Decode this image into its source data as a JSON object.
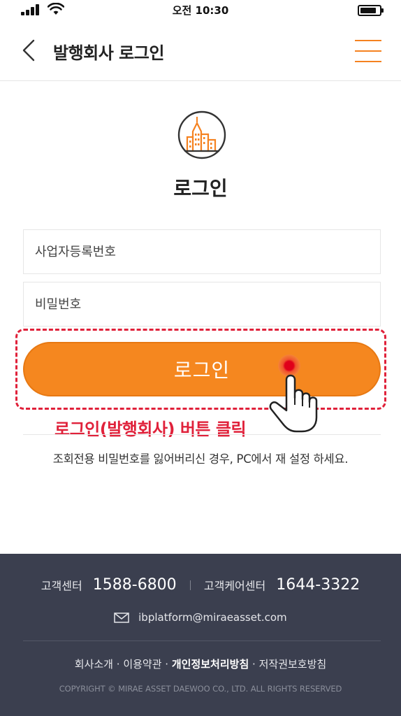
{
  "status_bar": {
    "time": "오전 10:30",
    "battery_level": 0.85
  },
  "header": {
    "title": "발행회사 로그인",
    "back_icon": "chevron-left-icon",
    "menu_icon": "hamburger-menu-icon"
  },
  "main": {
    "logo_icon": "building-icon",
    "heading": "로그인",
    "business_number_placeholder": "사업자등록번호",
    "password_placeholder": "비밀번호",
    "login_button_label": "로그인",
    "instruction": "로그인(발행회사) 버튼 클릭",
    "password_notice": "조회전용 비밀번호를 잃어버리신 경우, PC에서 재 설정 하세요."
  },
  "footer": {
    "customer_center_label": "고객센터",
    "customer_center_number": "1588-6800",
    "customer_care_label": "고객케어센터",
    "customer_care_number": "1644-3322",
    "email": "ibplatform@miraeasset.com",
    "links": {
      "about": "회사소개",
      "terms": "이용약관",
      "privacy": "개인정보처리방침",
      "copyright_policy": "저작권보호방침",
      "separator": "·"
    },
    "copyright": "COPYRIGHT © MIRAE ASSET DAEWOO CO., LTD. ALL RIGHTS RESERVED"
  },
  "colors": {
    "accent": "#f5871f",
    "highlight": "#e0213a",
    "footer_bg": "#3b3f4f"
  }
}
